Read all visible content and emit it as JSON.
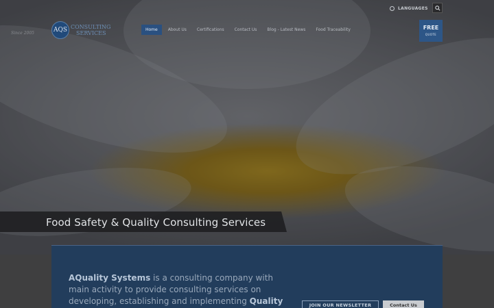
{
  "topbar": {
    "languages_label": "LANGUAGES",
    "globe_icon": "globe-icon",
    "search_icon": "search-icon"
  },
  "logo": {
    "monogram": "AQS",
    "line1": "CONSULTING",
    "line2": "SERVICES",
    "signature": "Since 2005"
  },
  "nav": {
    "items": [
      {
        "label": "Home",
        "active": true
      },
      {
        "label": "About Us"
      },
      {
        "label": "Certifications"
      },
      {
        "label": "Contact Us"
      },
      {
        "label": "Blog - Latest News"
      },
      {
        "label": "Food Traceability"
      }
    ]
  },
  "free_quote": {
    "big": "FREE",
    "small": "QUOTE"
  },
  "hero": {
    "tagline": "Food Safety & Quality Consulting Services"
  },
  "intro": {
    "company": "AQuality Systems",
    "text": " is a consulting company with main activity to provide consulting services on developing, establishing and implementing ",
    "emphasis": "Quality"
  },
  "buttons": {
    "newsletter": "JOIN OUR NEWSLETTER",
    "contact": "Contact Us"
  },
  "colors": {
    "accent": "#2a5080",
    "panel": "#223d5c"
  }
}
